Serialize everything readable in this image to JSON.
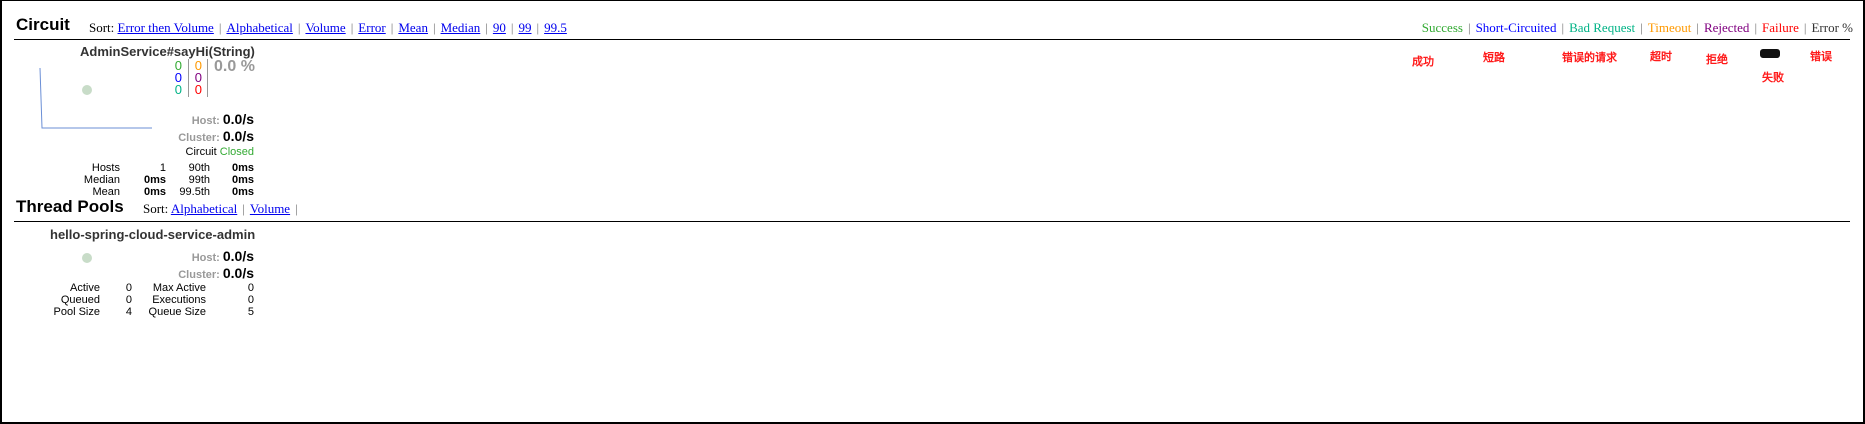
{
  "colors": {
    "success": "#33aa33",
    "short_circuited": "#0000ff",
    "bad_request": "#00b386",
    "timeout": "#ff9900",
    "rejected": "#800080",
    "failure": "#ff0000",
    "error": "#333333"
  },
  "circuit": {
    "title": "Circuit",
    "sort_label": "Sort:",
    "sort_options": [
      "Error then Volume",
      "Alphabetical",
      "Volume",
      "Error",
      "Mean",
      "Median",
      "90",
      "99",
      "99.5"
    ],
    "legend": [
      {
        "label": "Success",
        "key": "success"
      },
      {
        "label": "Short-Circuited",
        "key": "short_circuited"
      },
      {
        "label": "Bad Request",
        "key": "bad_request"
      },
      {
        "label": "Timeout",
        "key": "timeout"
      },
      {
        "label": "Rejected",
        "key": "rejected"
      },
      {
        "label": "Failure",
        "key": "failure"
      },
      {
        "label": "Error %",
        "key": "error"
      }
    ],
    "annotations": [
      "成功",
      "短路",
      "错误的请求",
      "超时",
      "拒绝",
      "失败",
      "错误"
    ],
    "card": {
      "name": "AdminService#sayHi(String)",
      "counts_left": [
        "0",
        "0",
        "0"
      ],
      "counts_right": [
        "0",
        "0",
        "0"
      ],
      "error_pct": "0.0 %",
      "host_label": "Host:",
      "host_value": "0.0/s",
      "cluster_label": "Cluster:",
      "cluster_value": "0.0/s",
      "circuit_label": "Circuit",
      "circuit_status": "Closed",
      "stats": {
        "hosts_label": "Hosts",
        "hosts_value": "1",
        "median_label": "Median",
        "median_value": "0ms",
        "mean_label": "Mean",
        "mean_value": "0ms",
        "p90_label": "90th",
        "p90_value": "0ms",
        "p99_label": "99th",
        "p99_value": "0ms",
        "p995_label": "99.5th",
        "p995_value": "0ms"
      }
    }
  },
  "thread_pools": {
    "title": "Thread Pools",
    "sort_label": "Sort:",
    "sort_options": [
      "Alphabetical",
      "Volume"
    ],
    "card": {
      "name": "hello-spring-cloud-service-admin",
      "host_label": "Host:",
      "host_value": "0.0/s",
      "cluster_label": "Cluster:",
      "cluster_value": "0.0/s",
      "stats": {
        "active_label": "Active",
        "active_value": "0",
        "queued_label": "Queued",
        "queued_value": "0",
        "pool_size_label": "Pool Size",
        "pool_size_value": "4",
        "max_active_label": "Max Active",
        "max_active_value": "0",
        "executions_label": "Executions",
        "executions_value": "0",
        "queue_size_label": "Queue Size",
        "queue_size_value": "5"
      }
    }
  }
}
